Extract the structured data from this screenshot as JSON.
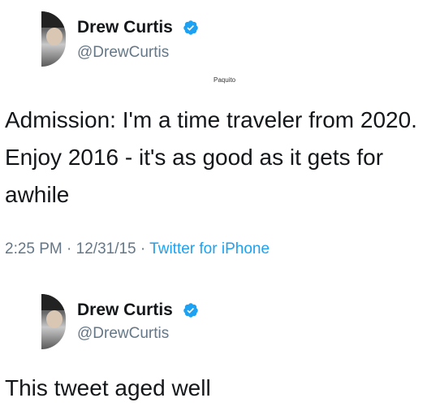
{
  "tweet1": {
    "name": "Drew Curtis",
    "handle": "@DrewCurtis",
    "text": "Admission: I'm a time traveler from 2020. Enjoy 2016 - it's as good as it gets for awhile",
    "time": "2:25 PM",
    "date": "12/31/15",
    "separator": "·",
    "client": "Twitter for iPhone",
    "verified_icon": "verified-badge-icon"
  },
  "watermark": "Paquito",
  "tweet2": {
    "name": "Drew Curtis",
    "handle": "@DrewCurtis",
    "text": "This tweet aged well",
    "verified_icon": "verified-badge-icon"
  },
  "colors": {
    "verified_blue": "#1da1f2",
    "handle_gray": "#657786",
    "text": "#14171a"
  }
}
